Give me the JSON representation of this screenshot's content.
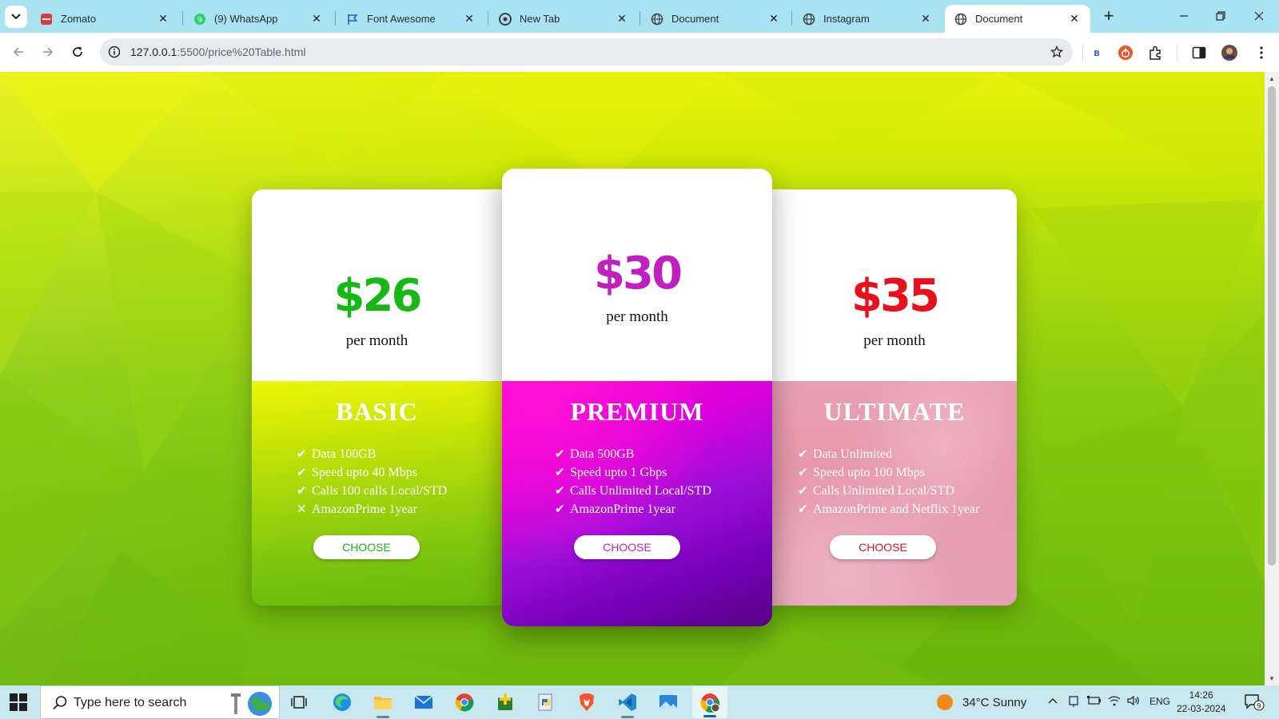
{
  "browser": {
    "tabs": [
      {
        "title": "Zomato",
        "icon": "zomato-icon",
        "active": false
      },
      {
        "title": "(9) WhatsApp",
        "icon": "whatsapp-icon",
        "active": false
      },
      {
        "title": "Font Awesome",
        "icon": "flag-icon",
        "active": false
      },
      {
        "title": "New Tab",
        "icon": "chrome-icon",
        "active": false
      },
      {
        "title": "Document",
        "icon": "globe-icon",
        "active": false
      },
      {
        "title": "Instagram",
        "icon": "globe-icon",
        "active": false
      },
      {
        "title": "Document",
        "icon": "globe-icon",
        "active": true
      }
    ],
    "url_host": "127.0.0.1",
    "url_path": ":5500/price%20Table.html",
    "extension_badge": "B"
  },
  "page": {
    "plans": [
      {
        "price": "$26",
        "period": "per month",
        "name": "BASIC",
        "color": "#16b814",
        "features": [
          {
            "mark": "✔",
            "text": "Data 100GB"
          },
          {
            "mark": "✔",
            "text": "Speed upto 40 Mbps"
          },
          {
            "mark": "✔",
            "text": "Calls 100 calls Local/STD"
          },
          {
            "mark": "✕",
            "text": "AmazonPrime 1year"
          }
        ],
        "cta": "CHOOSE"
      },
      {
        "price": "$30",
        "period": "per month",
        "name": "PREMIUM",
        "color": "#c21fc0",
        "features": [
          {
            "mark": "✔",
            "text": "Data 500GB"
          },
          {
            "mark": "✔",
            "text": "Speed upto 1 Gbps"
          },
          {
            "mark": "✔",
            "text": "Calls Unlimited Local/STD"
          },
          {
            "mark": "✔",
            "text": "AmazonPrime 1year"
          }
        ],
        "cta": "CHOOSE"
      },
      {
        "price": "$35",
        "period": "per month",
        "name": "ULTIMATE",
        "color": "#e8111b",
        "features": [
          {
            "mark": "✔",
            "text": "Data Unlimited"
          },
          {
            "mark": "✔",
            "text": "Speed upto 100 Mbps"
          },
          {
            "mark": "✔",
            "text": "Calls Unlimited Local/STD"
          },
          {
            "mark": "✔",
            "text": "AmazonPrime and Netflix 1year"
          }
        ],
        "cta": "CHOOSE"
      }
    ]
  },
  "taskbar": {
    "search_placeholder": "Type here to search",
    "weather": "34°C  Sunny",
    "language": "ENG",
    "time": "14:26",
    "date": "22-03-2024",
    "notification_count": "9"
  }
}
